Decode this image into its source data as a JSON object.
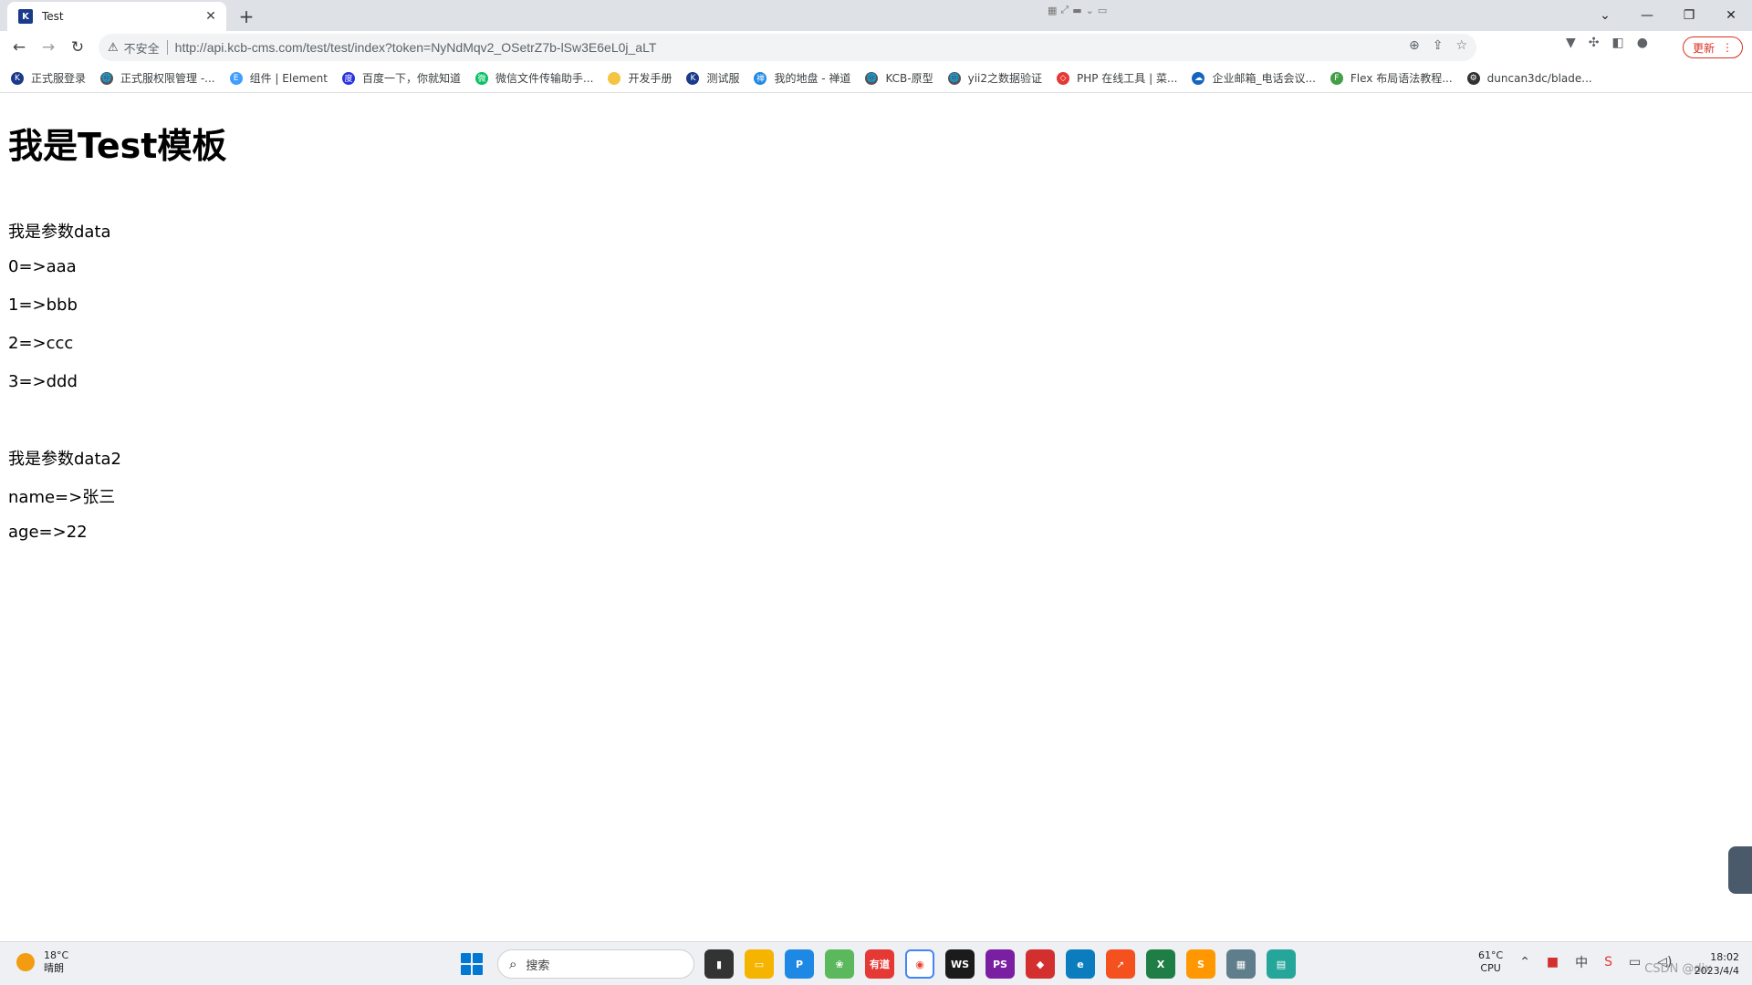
{
  "tab": {
    "title": "Test",
    "favicon": "K"
  },
  "window": {
    "minimize": "—",
    "restore": "❐",
    "close": "✕",
    "dropdown": "⌄"
  },
  "toolbar": {
    "insecure_label": "不安全",
    "url": "http://api.kcb-cms.com/test/test/index?token=NyNdMqv2_OSetrZ7b-lSw3E6eL0j_aLT",
    "update_label": "更新"
  },
  "bookmarks": [
    {
      "label": "正式服登录",
      "color": "#1a3a8a",
      "icon": "K"
    },
    {
      "label": "正式服权限管理 -...",
      "color": "#555555",
      "icon": "🌐"
    },
    {
      "label": "组件 | Element",
      "color": "#409eff",
      "icon": "E"
    },
    {
      "label": "百度一下，你就知道",
      "color": "#2932e1",
      "icon": "度"
    },
    {
      "label": "微信文件传输助手...",
      "color": "#07c160",
      "icon": "微"
    },
    {
      "label": "开发手册",
      "color": "#f4c542",
      "icon": ""
    },
    {
      "label": "测试服",
      "color": "#1a3a8a",
      "icon": "K"
    },
    {
      "label": "我的地盘 - 禅道",
      "color": "#1e88e5",
      "icon": "禅"
    },
    {
      "label": "KCB-原型",
      "color": "#555555",
      "icon": "🌐"
    },
    {
      "label": "yii2之数据验证",
      "color": "#555555",
      "icon": "🌐"
    },
    {
      "label": "PHP 在线工具 | 菜...",
      "color": "#e53935",
      "icon": "◇"
    },
    {
      "label": "企业邮箱_电话会议...",
      "color": "#1565c0",
      "icon": "☁"
    },
    {
      "label": "Flex 布局语法教程...",
      "color": "#43a047",
      "icon": "F"
    },
    {
      "label": "duncan3dc/blade...",
      "color": "#333333",
      "icon": "⚙"
    }
  ],
  "content": {
    "heading": "我是Test模板",
    "data_label": "我是参数data",
    "data_items": [
      "0=>aaa",
      "1=>bbb",
      "2=>ccc",
      "3=>ddd"
    ],
    "data2_label": "我是参数data2",
    "data2_items": [
      "name=>张三",
      "age=>22"
    ]
  },
  "taskbar": {
    "weather_temp": "18°C",
    "weather_desc": "晴朗",
    "search_placeholder": "搜索",
    "cpu_temp": "61°C",
    "cpu_label": "CPU",
    "time": "18:02",
    "date": "2023/4/4",
    "watermark": "CSDN @dix"
  }
}
